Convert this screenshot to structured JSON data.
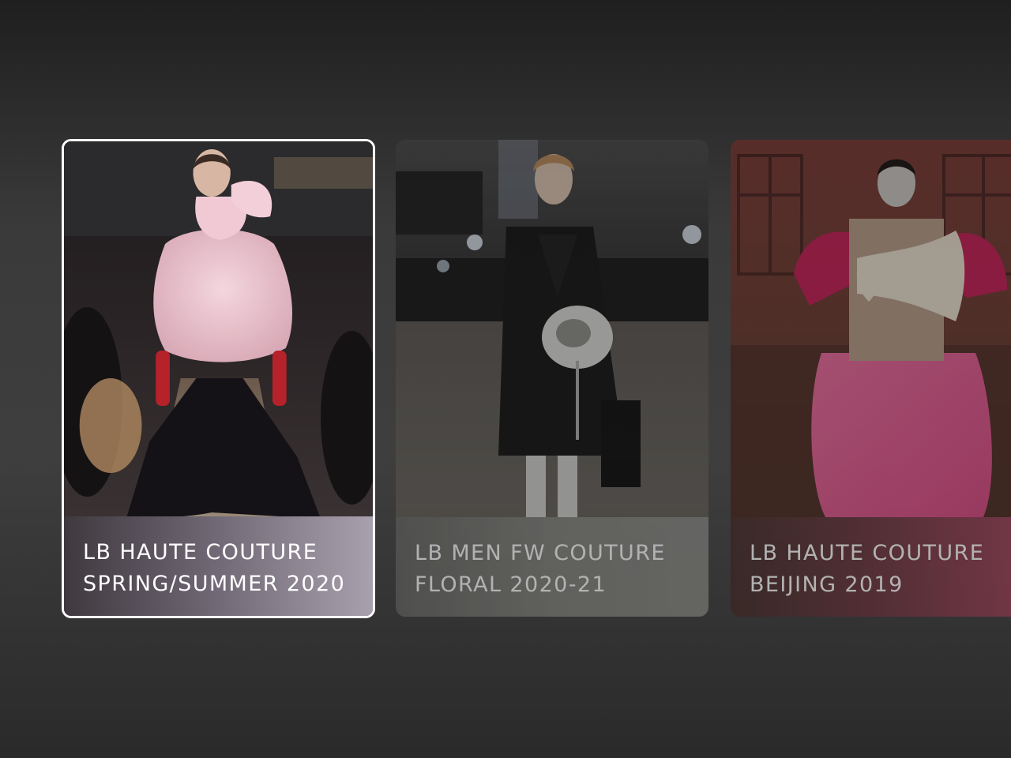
{
  "cards": [
    {
      "line1": "LB HAUTE COUTURE",
      "line2": "SPRING/SUMMER 2020",
      "focused": true
    },
    {
      "line1": "LB MEN FW COUTURE",
      "line2": "FLORAL 2020-21",
      "focused": false
    },
    {
      "line1": "LB HAUTE COUTURE",
      "line2": "BEIJING 2019",
      "focused": false
    }
  ],
  "colors": {
    "focus_ring": "#ffffff",
    "caption_text": "#ffffff"
  }
}
